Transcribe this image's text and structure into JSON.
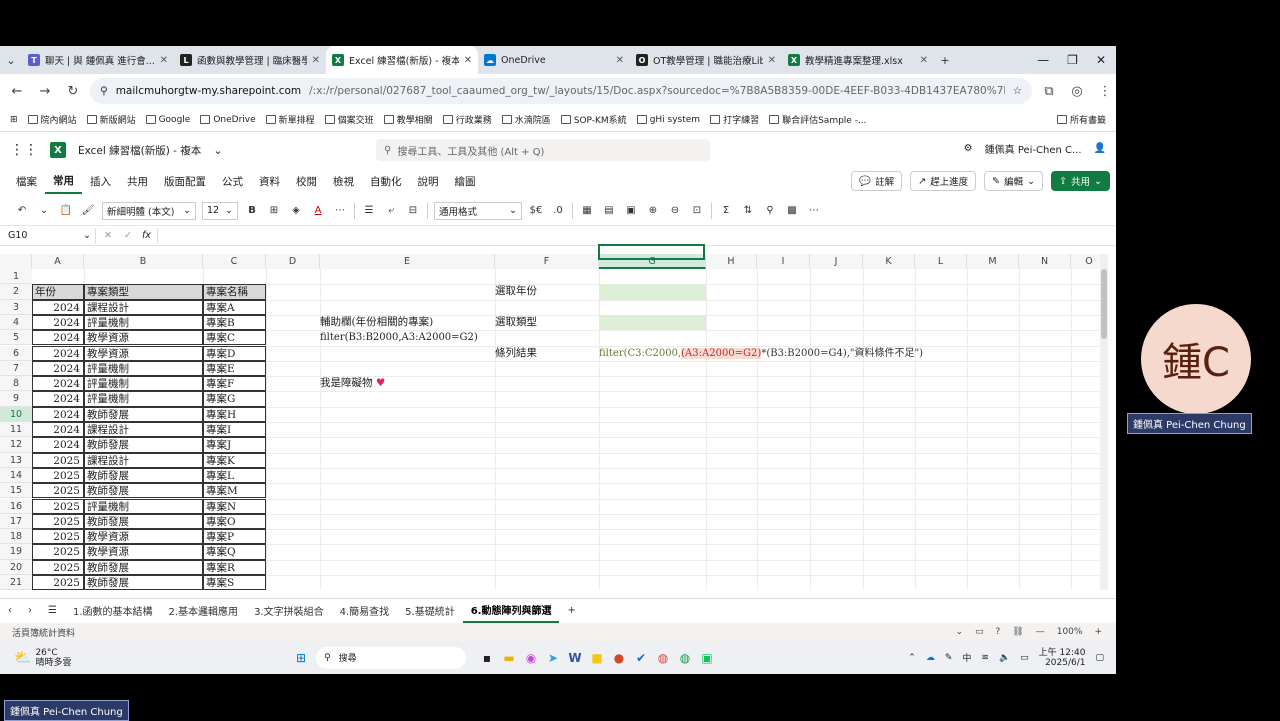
{
  "browser": {
    "tabs": [
      {
        "label": "聊天 | 與 鍾佩真 進行會...",
        "color": "#5b5fc7"
      },
      {
        "label": "函數與教學管理 | 臨床醫學...",
        "color": "#222222"
      },
      {
        "label": "Excel 練習檔(新版) - 複本...",
        "color": "#107c41",
        "active": true
      },
      {
        "label": "OneDrive",
        "color": "#0078d4"
      },
      {
        "label": "OT教學管理 | 職能治療Lib...",
        "color": "#222222"
      },
      {
        "label": "教學精進專案整理.xlsx",
        "color": "#107c41"
      }
    ],
    "url_host": "mailcmuhorgtw-my.sharepoint.com",
    "url_path": "/:x:/r/personal/027687_tool_caaumed_org_tw/_layouts/15/Doc.aspx?sourcedoc=%7B8A5B8359-00DE-4EEF-B033-4DB1437EA780%7D&file=Exc...",
    "bookmarks": [
      "院內網站",
      "新版網站",
      "Google",
      "OneDrive",
      "新單排程",
      "個案交班",
      "教學相關",
      "行政業務",
      "水湳院區",
      "SOP-KM系統",
      "gHi system",
      "打字練習",
      "聯合評估Sample -...",
      "所有書籤"
    ]
  },
  "excel": {
    "doc_title": "Excel 練習檔(新版) - 複本",
    "search_placeholder": "搜尋工具、工具及其他 (Alt + Q)",
    "user_name": "鍾佩真 Pei-Chen C...",
    "menus": [
      "檔案",
      "常用",
      "插入",
      "共用",
      "版面配置",
      "公式",
      "資料",
      "校閱",
      "檢視",
      "自動化",
      "說明",
      "繪圖"
    ],
    "active_menu": "常用",
    "btn_comment": "註解",
    "btn_catchup": "趕上進度",
    "btn_edit": "編輯",
    "btn_share": "共用",
    "font_name": "新細明體 (本文)",
    "font_size": "12",
    "number_format": "通用格式",
    "name_box": "G10",
    "columns": [
      "A",
      "B",
      "C",
      "D",
      "E",
      "F",
      "G",
      "H",
      "I",
      "J",
      "K",
      "L",
      "M",
      "N",
      "O"
    ],
    "rows": [
      "1",
      "2",
      "3",
      "4",
      "5",
      "6",
      "7",
      "8",
      "9",
      "10",
      "11",
      "12",
      "13",
      "14",
      "15",
      "16",
      "17",
      "18",
      "19",
      "20",
      "21"
    ],
    "table_headers": [
      "年份",
      "專案類型",
      "專案名稱"
    ],
    "table": [
      [
        "2024",
        "課程設計",
        "專案A"
      ],
      [
        "2024",
        "評量機制",
        "專案B"
      ],
      [
        "2024",
        "教學資源",
        "專案C"
      ],
      [
        "2024",
        "教學資源",
        "專案D"
      ],
      [
        "2024",
        "評量機制",
        "專案E"
      ],
      [
        "2024",
        "評量機制",
        "專案F"
      ],
      [
        "2024",
        "評量機制",
        "專案G"
      ],
      [
        "2024",
        "教師發展",
        "專案H"
      ],
      [
        "2024",
        "課程設計",
        "專案I"
      ],
      [
        "2024",
        "教師發展",
        "專案J"
      ],
      [
        "2025",
        "課程設計",
        "專案K"
      ],
      [
        "2025",
        "教師發展",
        "專案L"
      ],
      [
        "2025",
        "教師發展",
        "專案M"
      ],
      [
        "2025",
        "評量機制",
        "專案N"
      ],
      [
        "2025",
        "教師發展",
        "專案O"
      ],
      [
        "2025",
        "教學資源",
        "專案P"
      ],
      [
        "2025",
        "教學資源",
        "專案Q"
      ],
      [
        "2025",
        "教師發展",
        "專案R"
      ],
      [
        "2025",
        "教師發展",
        "專案S"
      ]
    ],
    "e4": "輔助欄(年份相關的專案)",
    "e5": "filter(B3:B2000,A3:A2000=G2)",
    "e8": "我是障礙物",
    "f2": "選取年份",
    "f4": "選取類型",
    "f6": "條列結果",
    "g6_a": "filter(C3:C2000,",
    "g6_b": "(A3:A2000=G2)",
    "g6_c": "*(B3:B2000=G4),\"資料條件不足\")",
    "sheets": [
      "1.函數的基本結構",
      "2.基本邏輯應用",
      "3.文字拼裝組合",
      "4.簡易查找",
      "5.基礎統計",
      "6.動態陣列與篩選"
    ],
    "active_sheet": "6.動態陣列與篩選",
    "status_left": "活頁簿統計資料",
    "zoom": "100%"
  },
  "taskbar": {
    "weather_temp": "26°C",
    "weather_desc": "晴時多雲",
    "search_label": "搜尋",
    "ime": "中",
    "time": "上午 12:40",
    "date": "2025/6/1"
  },
  "meeting": {
    "avatar_text": "鍾C",
    "participant_name": "鍾佩真 Pei-Chen Chung",
    "self_name": "鍾佩真 Pei-Chen Chung"
  }
}
